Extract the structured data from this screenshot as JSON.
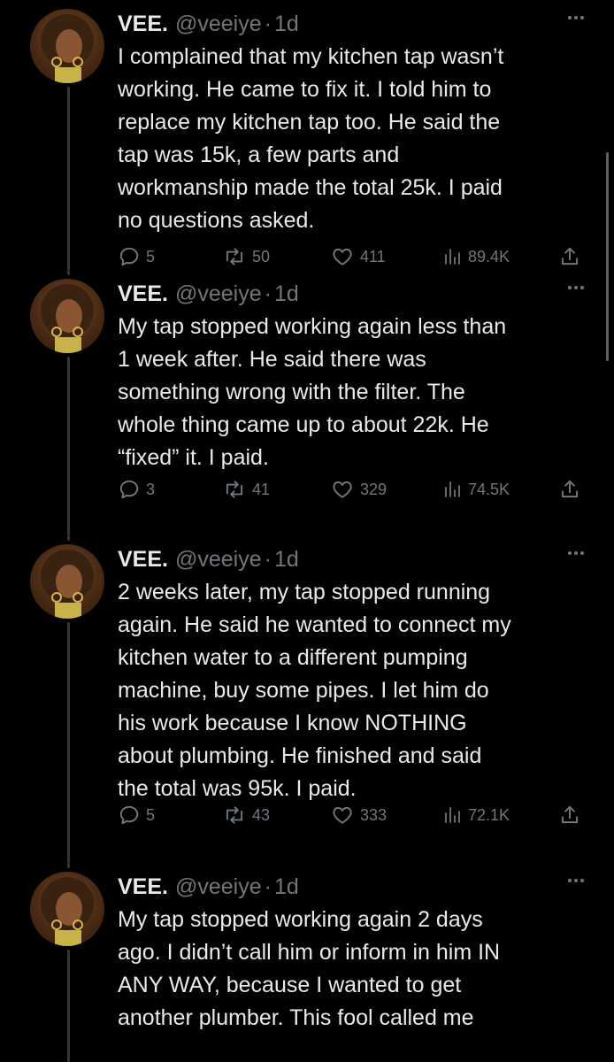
{
  "tweets": [
    {
      "display_name": "VEE.",
      "handle": "@veeiye",
      "separator": "·",
      "time": "1d",
      "text": "I complained that my kitchen tap wasn’t\nworking. He came to fix it. I told him to\nreplace my kitchen tap too. He said the\ntap was 15k, a few parts and\nworkmanship made the total 25k. I paid\nno questions asked.",
      "replies": "5",
      "retweets": "50",
      "likes": "411",
      "views": "89.4K"
    },
    {
      "display_name": "VEE.",
      "handle": "@veeiye",
      "separator": "·",
      "time": "1d",
      "text": "My tap stopped working again less than\n1 week after. He said there was\nsomething wrong with the filter. The\nwhole thing came up to about 22k. He\n“fixed” it. I paid.",
      "replies": "3",
      "retweets": "41",
      "likes": "329",
      "views": "74.5K"
    },
    {
      "display_name": "VEE.",
      "handle": "@veeiye",
      "separator": "·",
      "time": "1d",
      "text": "2 weeks later, my tap stopped running\nagain. He said he wanted to connect my\nkitchen water to a different pumping\nmachine, buy some pipes. I let him do\nhis work because I know NOTHING\nabout plumbing. He finished and said\nthe total was 95k. I paid.",
      "replies": "5",
      "retweets": "43",
      "likes": "333",
      "views": "72.1K"
    },
    {
      "display_name": "VEE.",
      "handle": "@veeiye",
      "separator": "·",
      "time": "1d",
      "text": "My tap stopped working again 2 days\nago. I didn’t call him or inform in him IN\nANY WAY, because I wanted to get\nanother plumber. This fool called me"
    }
  ],
  "icons": {
    "reply": "reply-icon",
    "retweet": "retweet-icon",
    "like": "heart-icon",
    "views": "views-icon",
    "share": "share-icon",
    "more": "more-icon"
  },
  "colors": {
    "background": "#000000",
    "text": "#e7e9ea",
    "secondary": "#71767b",
    "thread_line": "#333639"
  }
}
